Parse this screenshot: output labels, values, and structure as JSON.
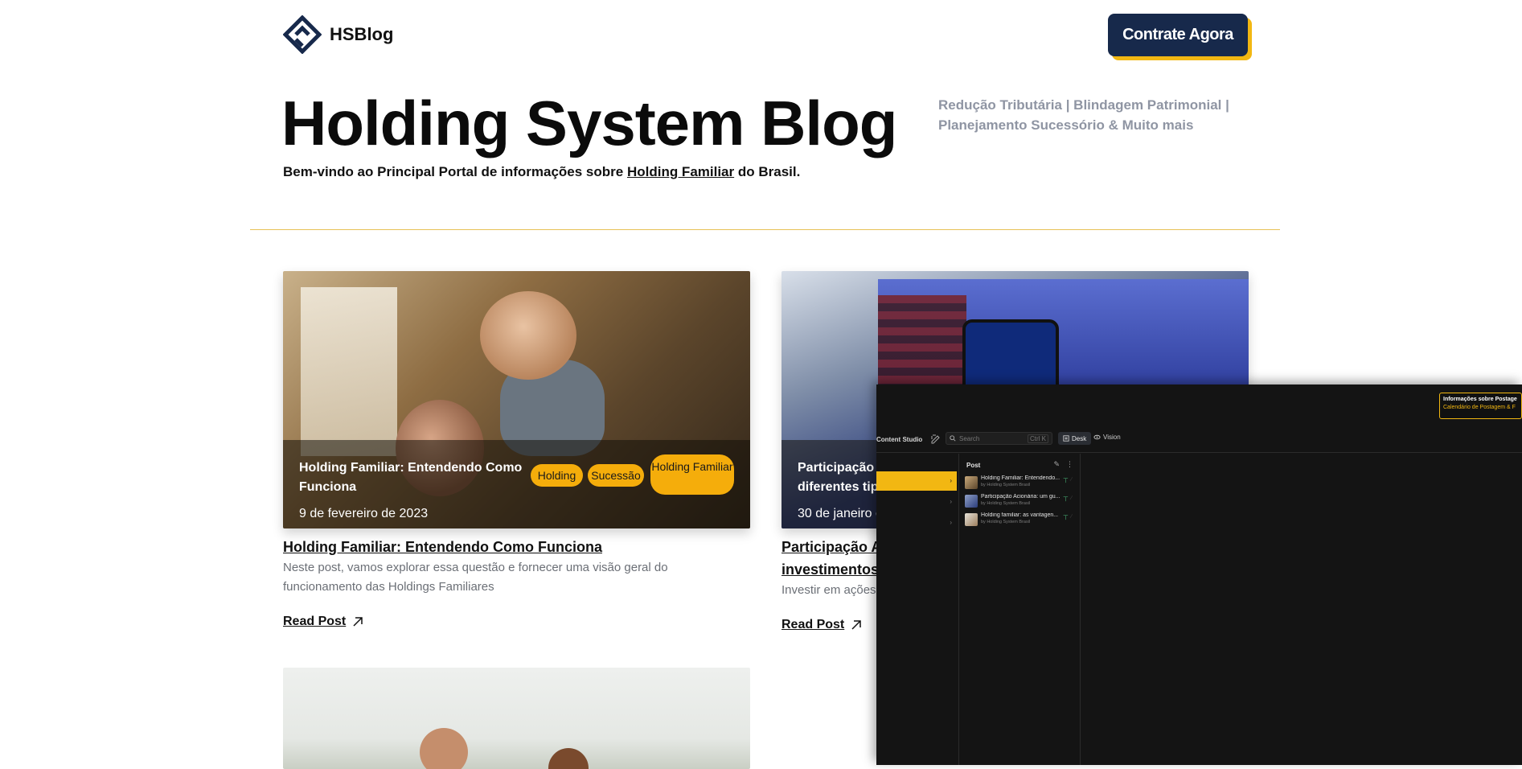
{
  "header": {
    "logo_text": "HSBlog",
    "cta_label": "Contrate Agora"
  },
  "hero": {
    "title": "Holding System Blog",
    "subtitle_before": "Bem-vindo ao Principal Portal de informações sobre ",
    "subtitle_link": "Holding Familiar",
    "subtitle_after": " do Brasil.",
    "tagline_line1": "Redução Tributária | Blindagem Patrimonial |",
    "tagline_line2": "Planejamento Sucessório & Muito mais"
  },
  "posts": [
    {
      "overlay_title": "Holding Familiar: Entendendo Como Funciona",
      "date": "9 de fevereiro de 2023",
      "tags": [
        "Holding",
        "Sucessão",
        "Holding Familiar"
      ],
      "title": "Holding Familiar: Entendendo Como Funciona",
      "excerpt": "Neste post, vamos explorar essa questão e fornecer uma visão geral do funcionamento das Holdings Familiares",
      "read_label": "Read Post"
    },
    {
      "overlay_title_line1": "Participação A",
      "overlay_title_line2": "diferentes tip",
      "date": "30 de janeiro c",
      "title_line1": "Participação A",
      "title_line2": "investimentos",
      "excerpt": "Investir em ações",
      "read_label": "Read Post"
    }
  ],
  "studio": {
    "name": "Content Studio",
    "search_placeholder": "Search",
    "search_shortcut": "Ctrl K",
    "desk_label": "Desk",
    "vision_label": "Vision",
    "notify_title": "Informações sobre Postage",
    "notify_sub": "Calendário de Postagem & F",
    "list_title": "Post",
    "items": [
      {
        "title": "Holding Familiar: Entendendo...",
        "by": "by Holding System Brasil"
      },
      {
        "title": "Participação Acionária: um gu...",
        "by": "by Holding System Brasil"
      },
      {
        "title": "Holding familiar: as vantagen...",
        "by": "by Holding System Brasil"
      }
    ]
  },
  "colors": {
    "brand": "#17294b",
    "accent": "#f2b712",
    "tag": "#f5ad0b"
  }
}
